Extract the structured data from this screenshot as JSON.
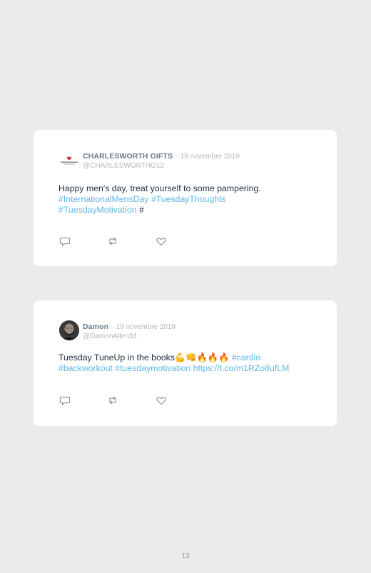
{
  "tweets": [
    {
      "name": "CHARLESWORTH GIFTS",
      "date": "· 19 novembre 2019",
      "handle": "@CHARLESWORTHG12",
      "avatar_icon": "charlesworth-logo",
      "text_plain": "Happy men's day, treat yourself to some pampering.",
      "hashtag_1": "#InternationalMensDay",
      "hashtag_2": "#TuesdayThoughts",
      "hashtag_3": "#TuesdayMotivation",
      "trailing": "#"
    },
    {
      "name": "Damon",
      "date": "· 19 novembre 2019",
      "handle": "@DamonAllen34",
      "avatar_icon": "profile-photo",
      "text_plain": "Tuesday TuneUp in the books💪👊🔥🔥🔥",
      "hashtag_1": "#cardio",
      "hashtag_2": "#backworkout",
      "hashtag_3": "#tuesdaymotivation",
      "link": "https://t.co/m1RZo8ufLM"
    }
  ],
  "actions": {
    "reply_icon": "reply-icon",
    "retweet_icon": "retweet-icon",
    "like_icon": "heart-icon"
  },
  "colors": {
    "background": "#ebebeb",
    "card": "#ffffff",
    "hashtag": "#5fb6e6",
    "name": "#6b7a88",
    "meta": "#b0b8bf"
  },
  "page_number": "13"
}
